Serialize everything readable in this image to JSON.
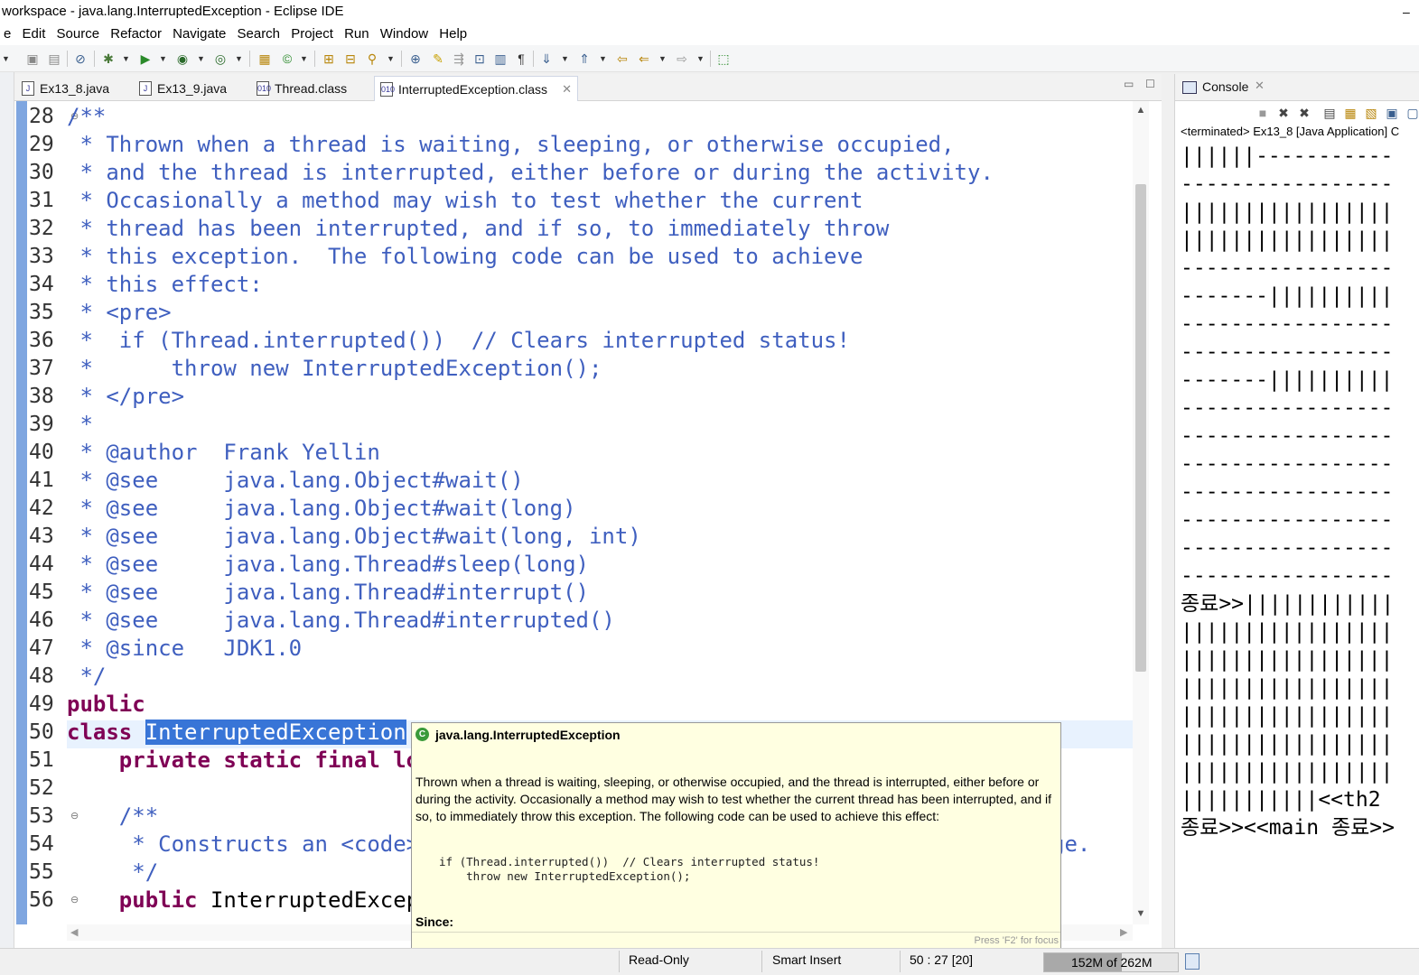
{
  "window": {
    "title": "workspace - java.lang.InterruptedException - Eclipse IDE",
    "minimize_glyph": "–"
  },
  "menu": [
    "e",
    "Edit",
    "Source",
    "Refactor",
    "Navigate",
    "Search",
    "Project",
    "Run",
    "Window",
    "Help"
  ],
  "editor_tabs": [
    {
      "label": "Ex13_8.java",
      "icon": "java-file-icon"
    },
    {
      "label": "Ex13_9.java",
      "icon": "java-file-icon"
    },
    {
      "label": "Thread.class",
      "icon": "class-file-icon"
    },
    {
      "label": "InterruptedException.class",
      "icon": "class-file-icon",
      "active": true
    }
  ],
  "editor": {
    "line_numbers": [
      "28",
      "29",
      "30",
      "31",
      "32",
      "33",
      "34",
      "35",
      "36",
      "37",
      "38",
      "39",
      "40",
      "41",
      "42",
      "43",
      "44",
      "45",
      "46",
      "47",
      "48",
      "49",
      "50",
      "51",
      "52",
      "53",
      "54",
      "55",
      "56"
    ],
    "lines": [
      "/**",
      " * Thrown when a thread is waiting, sleeping, or otherwise occupied,",
      " * and the thread is interrupted, either before or during the activity.",
      " * Occasionally a method may wish to test whether the current",
      " * thread has been interrupted, and if so, to immediately throw",
      " * this exception.  The following code can be used to achieve",
      " * this effect:",
      " * <pre>",
      " *  if (Thread.interrupted())  // Clears interrupted status!",
      " *      throw new InterruptedException();",
      " * </pre>",
      " *",
      " * @author  Frank Yellin",
      " * @see     java.lang.Object#wait()",
      " * @see     java.lang.Object#wait(long)",
      " * @see     java.lang.Object#wait(long, int)",
      " * @see     java.lang.Thread#sleep(long)",
      " * @see     java.lang.Thread#interrupt()",
      " * @see     java.lang.Thread#interrupted()",
      " * @since   JDK1.0",
      " */"
    ],
    "line49": "public",
    "line50_kw": "class ",
    "line50_selected": "InterruptedException",
    "line51_kw": "    private static final lo",
    "line53": "    /**",
    "line54": "     * Constructs an <code>",
    "line54_tail": "ge.",
    "line55": "     */",
    "line56_kw": "    public ",
    "line56_plain": "InterruptedExcep"
  },
  "console": {
    "tab_label": "Console",
    "status": "<terminated> Ex13_8 [Java Application] C",
    "output": [
      "||||||-----------",
      "-----------------",
      "|||||||||||||||||",
      "|||||||||||||||||",
      "-----------------",
      "-------||||||||||",
      "-----------------",
      "-----------------",
      "-------||||||||||",
      "-----------------",
      "-----------------",
      "-----------------",
      "-----------------",
      "-----------------",
      "-----------------",
      "-----------------",
      "종료>>||||||||||||",
      "|||||||||||||||||",
      "|||||||||||||||||",
      "|||||||||||||||||",
      "|||||||||||||||||",
      "|||||||||||||||||",
      "|||||||||||||||||",
      "|||||||||||<<th2",
      "종료>><<main 종료>>"
    ]
  },
  "tooltip": {
    "title": "java.lang.InterruptedException",
    "description": "Thrown when a thread is waiting, sleeping, or otherwise occupied, and the thread is interrupted, either before or during the activity. Occasionally a method may wish to test whether the current thread has been interrupted, and if so, to immediately throw this exception. The following code can be used to achieve this effect:",
    "code": "if (Thread.interrupted())  // Clears interrupted status!\n    throw new InterruptedException();",
    "since_label": "Since:",
    "focus_hint": "Press 'F2' for focus"
  },
  "statusbar": {
    "mode": "Read-Only",
    "insert": "Smart Insert",
    "position": "50 : 27 [20]",
    "heap": "152M of 262M",
    "heap_used_fraction": 0.58
  },
  "colors": {
    "comment": "#3f5fbf",
    "keyword": "#7f0055",
    "selection": "#3875d7",
    "tooltip_bg": "#ffffe1"
  }
}
